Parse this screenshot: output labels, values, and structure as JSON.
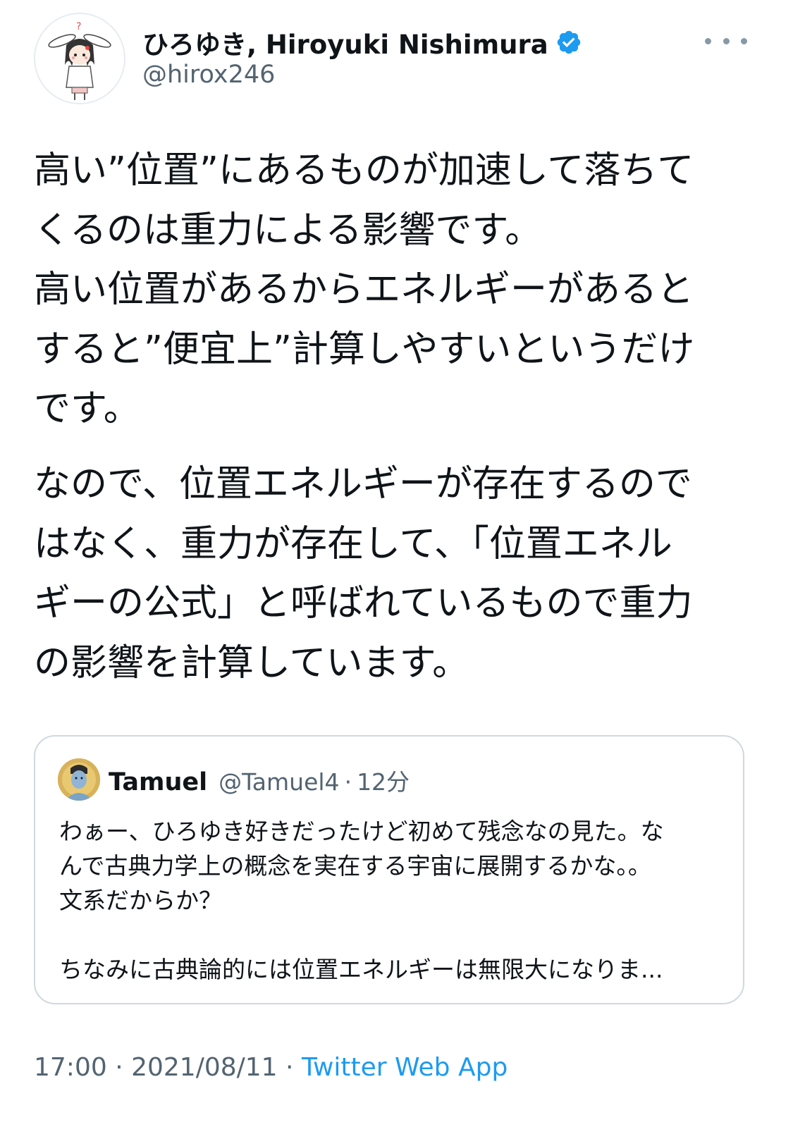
{
  "author": {
    "display_name": "ひろゆき, Hiroyuki Nishimura",
    "handle": "@hirox246",
    "verified_icon": "verified-badge-icon",
    "avatar_icon": "bunny-girl-avatar"
  },
  "menu": {
    "icon": "more-horizontal-icon"
  },
  "tweet": {
    "paragraphs": [
      {
        "lines": [
          "高い”位置”にあるものが加速して落ちて",
          "くるのは重力による影響です。",
          "高い位置があるからエネルギーがあると",
          "すると”便宜上”計算しやすいというだけ",
          "です。"
        ]
      },
      {
        "lines": [
          "なので、位置エネルギーが存在するので",
          "はなく、重力が存在して、「位置エネル",
          "ギーの公式」と呼ばれているもので重力",
          "の影響を計算しています。"
        ]
      }
    ]
  },
  "quote": {
    "name": "Tamuel",
    "handle": "@Tamuel4",
    "separator": "·",
    "time": "12分",
    "lines": [
      "わぁー、ひろゆき好きだったけど初めて残念なの見た。な",
      "んで古典力学上の概念を実在する宇宙に展開するかな。。",
      "文系だからか？",
      "",
      "ちなみに古典論的には位置エネルギーは無限大になりま..."
    ]
  },
  "footer": {
    "time": "17:00",
    "sep1": " · ",
    "date": "2021/08/11",
    "sep2": " · ",
    "source": "Twitter Web App"
  },
  "colors": {
    "text": "#0f1419",
    "secondary": "#536471",
    "link": "#1d9bf0",
    "verified": "#1d9bf0",
    "border": "#cfd9de"
  }
}
